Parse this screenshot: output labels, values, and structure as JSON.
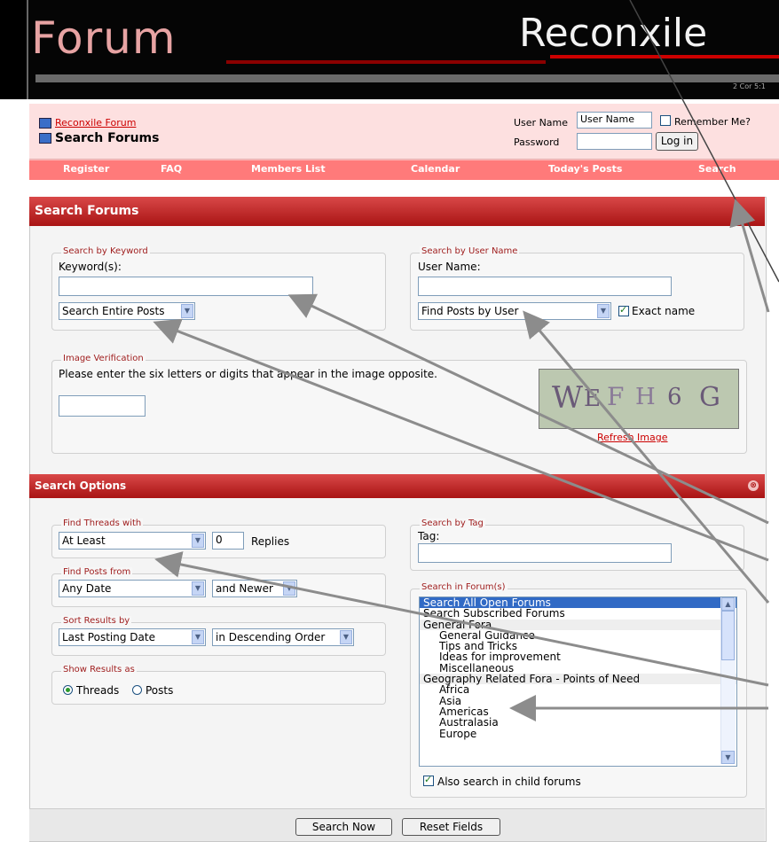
{
  "header": {
    "forum_logo": "Forum",
    "site_logo": "Reconxile",
    "motto": "2 Cor 5:1"
  },
  "breadcrumb": {
    "parent": "Reconxile Forum",
    "current": "Search Forums"
  },
  "login": {
    "username_label": "User Name",
    "username_value": "User Name",
    "remember_label": "Remember Me?",
    "password_label": "Password",
    "login_button": "Log in"
  },
  "nav": {
    "register": "Register",
    "faq": "FAQ",
    "members": "Members List",
    "calendar": "Calendar",
    "todays_posts": "Today's Posts",
    "search": "Search"
  },
  "search_forums": {
    "title": "Search Forums",
    "keyword": {
      "legend": "Search by Keyword",
      "label": "Keyword(s):",
      "value": "",
      "scope": "Search Entire Posts"
    },
    "username": {
      "legend": "Search by User Name",
      "label": "User Name:",
      "value": "",
      "mode": "Find Posts by User",
      "exact_label": "Exact name",
      "exact_checked": true
    },
    "verification": {
      "legend": "Image Verification",
      "instruction": "Please enter the six letters or digits that appear in the image opposite.",
      "captcha_text": "WEFH6G",
      "refresh": "Refresh Image"
    }
  },
  "search_options": {
    "title": "Search Options",
    "threads_with": {
      "legend": "Find Threads with",
      "mode": "At Least",
      "count": "0",
      "suffix": "Replies"
    },
    "posts_from": {
      "legend": "Find Posts from",
      "when": "Any Date",
      "direction": "and Newer"
    },
    "sort": {
      "legend": "Sort Results by",
      "field": "Last Posting Date",
      "order": "in Descending Order"
    },
    "show_as": {
      "legend": "Show Results as",
      "threads": "Threads",
      "posts": "Posts",
      "selected": "threads"
    },
    "tag": {
      "legend": "Search by Tag",
      "label": "Tag:",
      "value": ""
    },
    "forums": {
      "legend": "Search in Forum(s)",
      "items": [
        {
          "label": "Search All Open Forums",
          "kind": "selected"
        },
        {
          "label": "Search Subscribed Forums",
          "kind": "top"
        },
        {
          "label": "General Fora",
          "kind": "group"
        },
        {
          "label": "General Guidance",
          "kind": "sub"
        },
        {
          "label": "Tips and Tricks",
          "kind": "sub"
        },
        {
          "label": "Ideas for improvement",
          "kind": "sub"
        },
        {
          "label": "Miscellaneous",
          "kind": "sub"
        },
        {
          "label": "Geography Related Fora - Points of Need",
          "kind": "group"
        },
        {
          "label": "Africa",
          "kind": "sub"
        },
        {
          "label": "Asia",
          "kind": "sub"
        },
        {
          "label": "Americas",
          "kind": "sub"
        },
        {
          "label": "Australasia",
          "kind": "sub"
        },
        {
          "label": "Europe",
          "kind": "sub"
        }
      ],
      "child_label": "Also search in child forums",
      "child_checked": true
    }
  },
  "actions": {
    "search_now": "Search Now",
    "reset": "Reset Fields"
  },
  "colors": {
    "title_bar": "#b81c1c",
    "nav_bar": "#ff7a7a",
    "header_bg": "#000000",
    "link": "#cc0000"
  }
}
